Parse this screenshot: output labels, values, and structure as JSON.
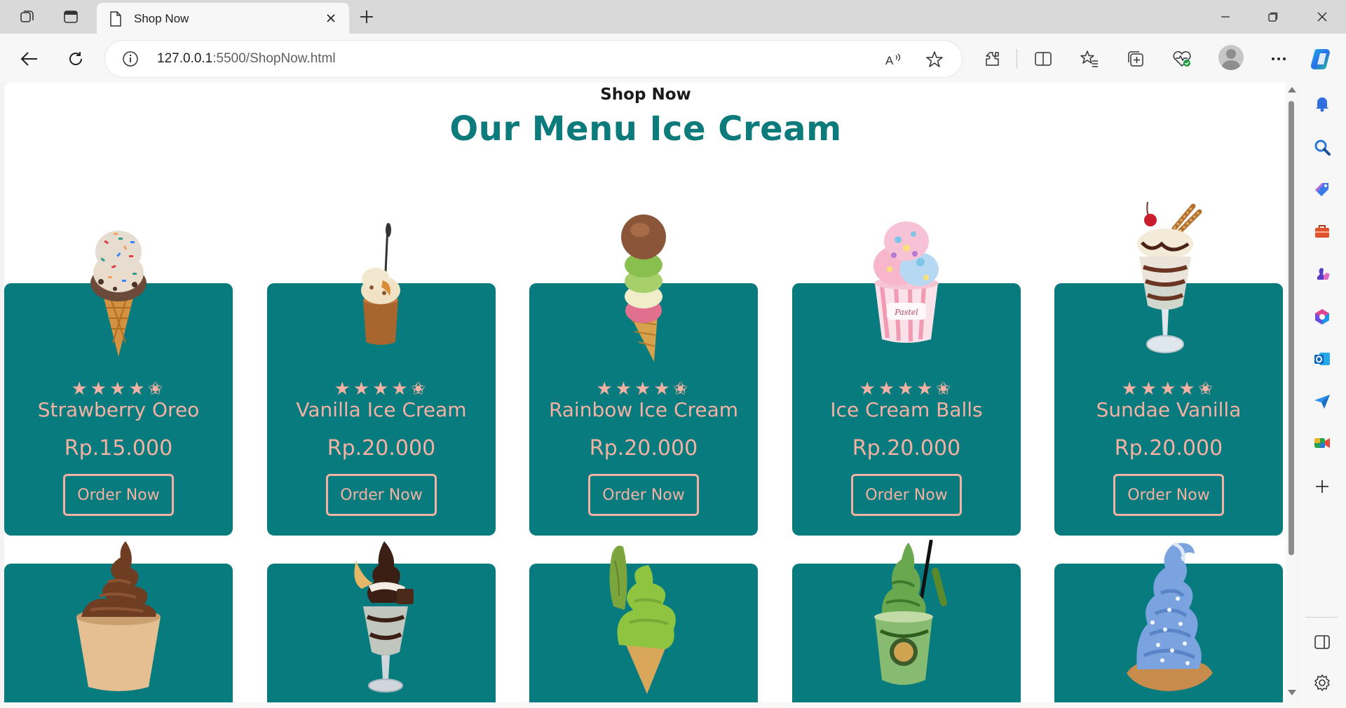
{
  "browser": {
    "tab_title": "Shop Now",
    "url_host": "127.0.0.1",
    "url_path": ":5500/ShopNow.html"
  },
  "page": {
    "subtitle": "Shop Now",
    "title": "Our Menu Ice Cream",
    "order_label": "Order Now",
    "stars": "★★★★✬",
    "rating": 4.5,
    "products": [
      {
        "name": "Strawberry Oreo",
        "price": "Rp.15.000"
      },
      {
        "name": "Vanilla Ice Cream",
        "price": "Rp.20.000"
      },
      {
        "name": "Rainbow Ice Cream",
        "price": "Rp.20.000"
      },
      {
        "name": "Ice Cream Balls",
        "price": "Rp.20.000"
      },
      {
        "name": "Sundae Vanilla",
        "price": "Rp.20.000"
      }
    ]
  },
  "colors": {
    "card_bg": "#077b7e",
    "accent_text": "#f2b1a3",
    "title": "#0d7a7c"
  }
}
